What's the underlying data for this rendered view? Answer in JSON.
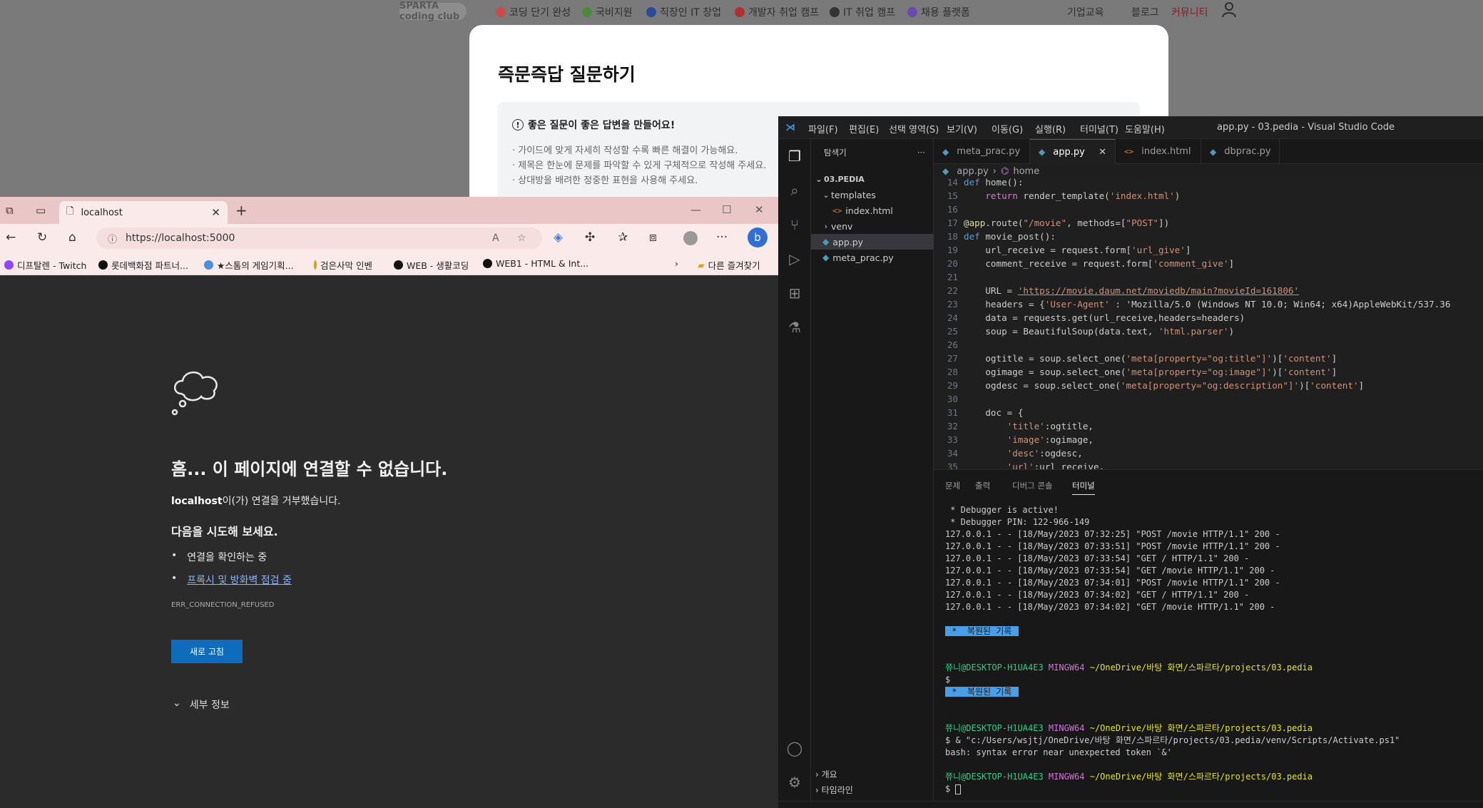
{
  "bg_page": {
    "logo": "SPARTA coding club",
    "nav_items": [
      {
        "label": "코딩 단기 완성",
        "color": "#c94a4a"
      },
      {
        "label": "국비지원",
        "color": "#4a8a3a"
      },
      {
        "label": "직장인 IT 창업",
        "color": "#2a4a9a"
      },
      {
        "label": "개발자 취업 캠프",
        "color": "#b03030"
      },
      {
        "label": "IT 취업 캠프",
        "color": "#333333"
      },
      {
        "label": "채용 플랫폼",
        "color": "#6a4ab0"
      }
    ],
    "nav_right": [
      "기업교육",
      "블로그",
      "커뮤니티"
    ],
    "card_title": "즉문즉답 질문하기",
    "guide_title": "좋은 질문이 좋은 답변을 만들어요!",
    "guide_lines": [
      "· 가이드에 맞게 자세히 작성할 수록 빠른 해결이 가능해요.",
      "· 제목은 한눈에 문제를 파악할 수 있게 구체적으로 작성해 주세요.",
      "· 상대방을 배려한 정중한 표현을 사용해 주세요."
    ]
  },
  "browser": {
    "tab_title": "localhost",
    "address": "https://localhost:5000",
    "favorites": [
      {
        "label": "디프탈렌 - Twitch",
        "color": "#9146ff"
      },
      {
        "label": "롯데백화점 파트너...",
        "color": "#111111"
      },
      {
        "label": "★스톰의 게임기획...",
        "color": "#4a90e2"
      },
      {
        "label": "검은사막 인벤",
        "color": "#d4a017"
      },
      {
        "label": "WEB - 생활코딩",
        "color": "#111111"
      },
      {
        "label": "WEB1 - HTML & Int...",
        "color": "#111111"
      }
    ],
    "other_favorites": "다른 즐겨찾기",
    "error": {
      "title": "흠... 이 페이지에 연결할 수 없습니다.",
      "desc_host": "localhost",
      "desc_rest": "이(가) 연결을 거부했습니다.",
      "try_title": "다음을 시도해 보세요.",
      "try_items": [
        "연결을 확인하는 중",
        "프록시 및 방화벽 점검 중"
      ],
      "code": "ERR_CONNECTION_REFUSED",
      "reload_label": "새로 고침",
      "details_label": "세부 정보"
    }
  },
  "vscode": {
    "menu": [
      "파일(F)",
      "편집(E)",
      "선택 영역(S)",
      "보기(V)",
      "이동(G)",
      "실행(R)",
      "터미널(T)",
      "도움말(H)"
    ],
    "window_title": "app.py - 03.pedia - Visual Studio Code",
    "explorer_title": "탐색기",
    "explorer": {
      "root": "03.PEDIA",
      "items": [
        {
          "label": "templates",
          "type": "folder-open"
        },
        {
          "label": "index.html",
          "type": "html"
        },
        {
          "label": "venv",
          "type": "folder"
        },
        {
          "label": "app.py",
          "type": "py",
          "active": true
        },
        {
          "label": "meta_prac.py",
          "type": "py"
        }
      ]
    },
    "tabs": [
      {
        "label": "meta_prac.py",
        "type": "py"
      },
      {
        "label": "app.py",
        "type": "py",
        "active": true
      },
      {
        "label": "index.html",
        "type": "html"
      },
      {
        "label": "dbprac.py",
        "type": "py"
      }
    ],
    "breadcrumb": [
      "app.py",
      "home"
    ],
    "code_lines": [
      {
        "n": "14",
        "t": "def home():"
      },
      {
        "n": "15",
        "t": "    return render_template('index.html')"
      },
      {
        "n": "16",
        "t": ""
      },
      {
        "n": "17",
        "t": "@app.route(\"/movie\", methods=[\"POST\"])"
      },
      {
        "n": "18",
        "t": "def movie_post():"
      },
      {
        "n": "19",
        "t": "    url_receive = request.form['url_give']"
      },
      {
        "n": "20",
        "t": "    comment_receive = request.form['comment_give']"
      },
      {
        "n": "21",
        "t": ""
      },
      {
        "n": "22",
        "t": "    URL = 'https://movie.daum.net/moviedb/main?movieId=161806'"
      },
      {
        "n": "23",
        "t": "    headers = {'User-Agent' : 'Mozilla/5.0 (Windows NT 10.0; Win64; x64)AppleWebKit/537.36"
      },
      {
        "n": "24",
        "t": "    data = requests.get(url_receive,headers=headers)"
      },
      {
        "n": "25",
        "t": "    soup = BeautifulSoup(data.text, 'html.parser')"
      },
      {
        "n": "26",
        "t": ""
      },
      {
        "n": "27",
        "t": "    ogtitle = soup.select_one('meta[property=\"og:title\"]')['content']"
      },
      {
        "n": "28",
        "t": "    ogimage = soup.select_one('meta[property=\"og:image\"]')['content']"
      },
      {
        "n": "29",
        "t": "    ogdesc = soup.select_one('meta[property=\"og:description\"]')['content']"
      },
      {
        "n": "30",
        "t": ""
      },
      {
        "n": "31",
        "t": "    doc = {"
      },
      {
        "n": "32",
        "t": "        'title':ogtitle,"
      },
      {
        "n": "33",
        "t": "        'image':ogimage,"
      },
      {
        "n": "34",
        "t": "        'desc':ogdesc,"
      },
      {
        "n": "35",
        "t": "        'url':url_receive,"
      }
    ],
    "panel_tabs": [
      "문제",
      "출력",
      "디버그 콘솔",
      "터미널"
    ],
    "terminal_lines": [
      " * Debugger is active!",
      " * Debugger PIN: 122-966-149",
      "127.0.0.1 - - [18/May/2023 07:32:25] \"POST /movie HTTP/1.1\" 200 -",
      "127.0.0.1 - - [18/May/2023 07:33:51] \"POST /movie HTTP/1.1\" 200 -",
      "127.0.0.1 - - [18/May/2023 07:33:54] \"GET / HTTP/1.1\" 200 -",
      "127.0.0.1 - - [18/May/2023 07:33:54] \"GET /movie HTTP/1.1\" 200 -",
      "127.0.0.1 - - [18/May/2023 07:34:01] \"POST /movie HTTP/1.1\" 200 -",
      "127.0.0.1 - - [18/May/2023 07:34:02] \"GET / HTTP/1.1\" 200 -",
      "127.0.0.1 - - [18/May/2023 07:34:02] \"GET /movie HTTP/1.1\" 200 -"
    ],
    "restored_label": " *  복원된 기록 ",
    "prompt_user": "쮸니@DESKTOP-H1UA4E3",
    "prompt_host": "MINGW64",
    "prompt_path": "~/OneDrive/바탕 화면/스파르타/projects/03.pedia",
    "cmd_activate": "$ & \"c:/Users/wsjtj/OneDrive/바탕 화면/스파르타/projects/03.pedia/venv/Scripts/Activate.ps1\"",
    "bash_error": "bash: syntax error near unexpected token `&'",
    "outline_labels": [
      "개요",
      "타임라인"
    ]
  }
}
